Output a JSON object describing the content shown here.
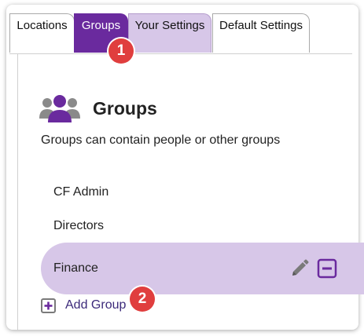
{
  "tabs": [
    {
      "label": "Locations"
    },
    {
      "label": "Groups"
    },
    {
      "label": "Your Settings"
    },
    {
      "label": "Default Settings"
    }
  ],
  "callouts": {
    "first": "1",
    "second": "2"
  },
  "section": {
    "title": "Groups",
    "description": "Groups can contain people or other groups",
    "icon": "people-group-icon"
  },
  "groups": [
    {
      "name": "CF Admin"
    },
    {
      "name": "Directors"
    },
    {
      "name": "Finance",
      "selected": true
    }
  ],
  "actions": {
    "edit_icon": "pencil-icon",
    "remove_icon": "minus-box-icon",
    "add_label": "Add Group",
    "add_icon": "plus-box-icon"
  },
  "colors": {
    "accent": "#6a2a9e",
    "accent_light": "#d7c7e8",
    "callout": "#e03e3e",
    "icon_gray": "#7a7a7a"
  }
}
